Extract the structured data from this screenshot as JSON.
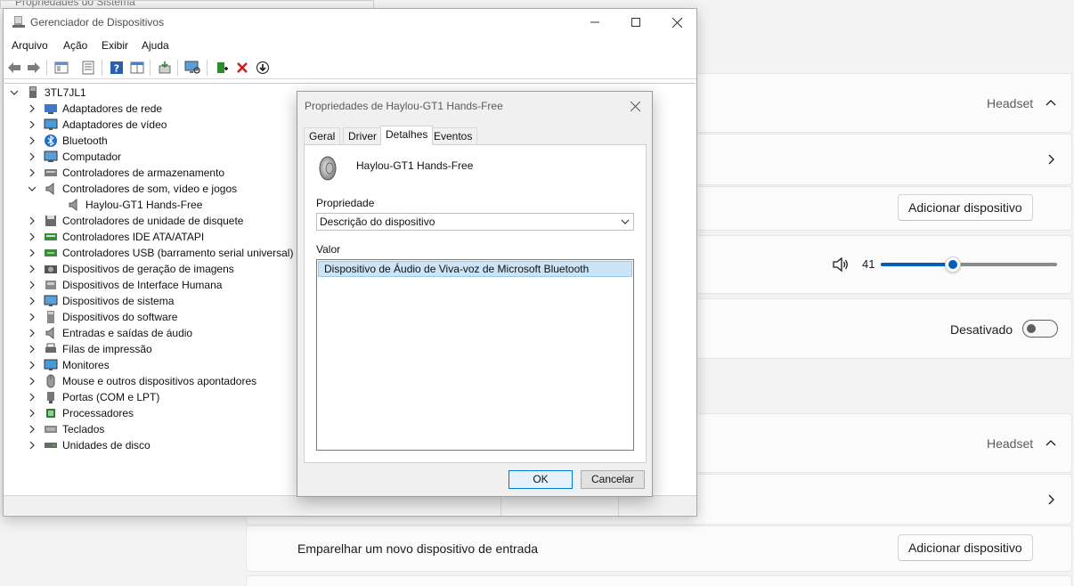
{
  "settings": {
    "headset_label_1": "Headset",
    "headset_label_2": "Headset",
    "add_device_1": "Adicionar dispositivo",
    "add_device_2": "Adicionar dispositivo",
    "volume_value": "41",
    "volume_level": 0.41,
    "toggle_state_label": "Desativado",
    "pair_input_label": "Emparelhar um novo dispositivo de entrada",
    "behind_window_title": "Propriedades do Sistema"
  },
  "device_manager": {
    "title": "Gerenciador de Dispositivos",
    "menu": [
      "Arquivo",
      "Ação",
      "Exibir",
      "Ajuda"
    ],
    "root": "3TL7JL1",
    "tree": [
      {
        "label": "Adaptadores de rede",
        "icon": "network-adapter-icon",
        "expanded": false
      },
      {
        "label": "Adaptadores de vídeo",
        "icon": "display-adapter-icon",
        "expanded": false
      },
      {
        "label": "Bluetooth",
        "icon": "bluetooth-icon",
        "expanded": false
      },
      {
        "label": "Computador",
        "icon": "computer-icon",
        "expanded": false
      },
      {
        "label": "Controladores de armazenamento",
        "icon": "storage-controller-icon",
        "expanded": false
      },
      {
        "label": "Controladores de som, vídeo e jogos",
        "icon": "speaker-icon",
        "expanded": true
      },
      {
        "label": "Haylou-GT1 Hands-Free",
        "icon": "speaker-icon",
        "child": true
      },
      {
        "label": "Controladores de unidade de disquete",
        "icon": "floppy-icon",
        "expanded": false
      },
      {
        "label": "Controladores IDE ATA/ATAPI",
        "icon": "ide-controller-icon",
        "expanded": false
      },
      {
        "label": "Controladores USB (barramento serial universal)",
        "icon": "usb-icon",
        "expanded": false
      },
      {
        "label": "Dispositivos de geração de imagens",
        "icon": "camera-icon",
        "expanded": false
      },
      {
        "label": "Dispositivos de Interface Humana",
        "icon": "hid-icon",
        "expanded": false
      },
      {
        "label": "Dispositivos de sistema",
        "icon": "system-device-icon",
        "expanded": false
      },
      {
        "label": "Dispositivos do software",
        "icon": "software-device-icon",
        "expanded": false
      },
      {
        "label": "Entradas e saídas de áudio",
        "icon": "audio-io-icon",
        "expanded": false
      },
      {
        "label": "Filas de impressão",
        "icon": "printer-icon",
        "expanded": false
      },
      {
        "label": "Monitores",
        "icon": "monitor-icon",
        "expanded": false
      },
      {
        "label": "Mouse e outros dispositivos apontadores",
        "icon": "mouse-icon",
        "expanded": false
      },
      {
        "label": "Portas (COM e LPT)",
        "icon": "port-icon",
        "expanded": false
      },
      {
        "label": "Processadores",
        "icon": "processor-icon",
        "expanded": false
      },
      {
        "label": "Teclados",
        "icon": "keyboard-icon",
        "expanded": false
      },
      {
        "label": "Unidades de disco",
        "icon": "disk-drive-icon",
        "expanded": false
      }
    ]
  },
  "dialog": {
    "title": "Propriedades de Haylou-GT1 Hands-Free",
    "tabs": [
      "Geral",
      "Driver",
      "Detalhes",
      "Eventos"
    ],
    "active_tab": "Detalhes",
    "device_name": "Haylou-GT1 Hands-Free",
    "property_label": "Propriedade",
    "property_value": "Descrição do dispositivo",
    "value_label": "Valor",
    "value_items": [
      "Dispositivo de Áudio de Viva-voz de Microsoft Bluetooth"
    ],
    "ok": "OK",
    "cancel": "Cancelar"
  }
}
